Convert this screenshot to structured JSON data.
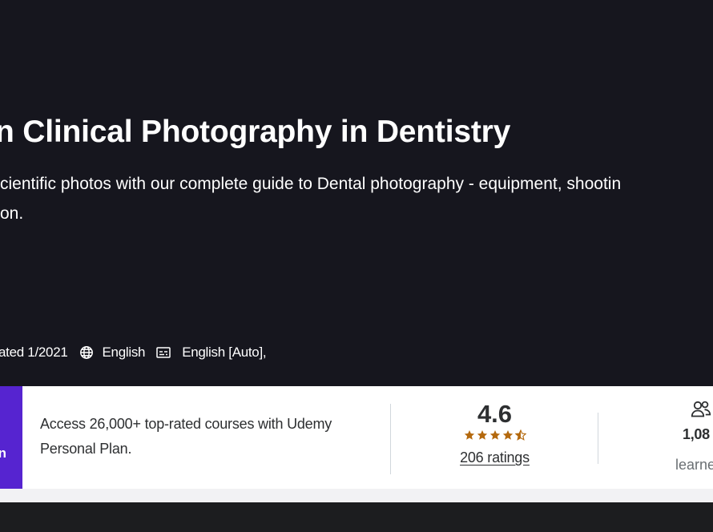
{
  "course": {
    "title": "n Clinical Photography in Dentistry",
    "subtitle_line1": "cientific photos with our complete guide to Dental photography - equipment, shootin",
    "subtitle_line2": "on."
  },
  "meta": {
    "updated": "ated 1/2021",
    "language": "English",
    "captions": "English [Auto],",
    "globe_icon": "globe-icon",
    "captions_icon": "closed-captions-icon"
  },
  "banner": {
    "cta_label": "n",
    "plan_text": "Access 26,000+ top-rated courses with Udemy Personal Plan.",
    "rating_value": "4.6",
    "rating_stars": 4.5,
    "rating_count": "206 ratings",
    "learners_count": "1,08",
    "learners_label": "learne",
    "learners_icon": "people-icon"
  },
  "colors": {
    "hero_bg": "#16161e",
    "cta_purple": "#5624d0",
    "star_orange": "#b4690e",
    "text_dark": "#2d2f31"
  }
}
